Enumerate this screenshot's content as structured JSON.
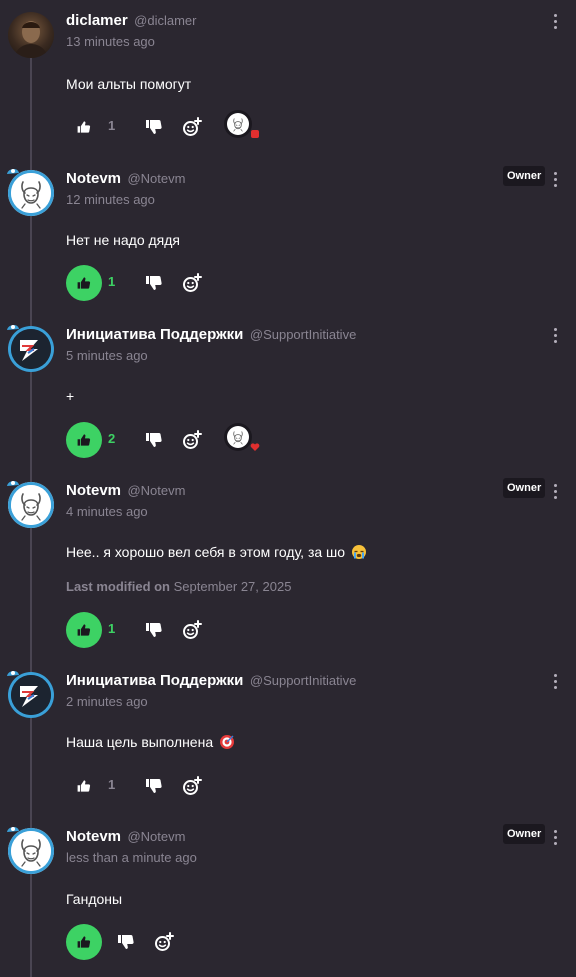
{
  "colors": {
    "background": "#2b2730",
    "like_active": "#3dd264",
    "muted": "#8a8592",
    "owner_badge_bg": "#1b181f"
  },
  "comments": [
    {
      "author": "diclamer",
      "handle": "@diclamer",
      "time": "13 minutes ago",
      "text": "Мои альты помогут",
      "likes": "1",
      "liked": false,
      "owner": false,
      "avatar": "user-photo",
      "reaction": true
    },
    {
      "author": "Notevm",
      "handle": "@Notevm",
      "time": "12 minutes ago",
      "text": "Нет не надо дядя",
      "likes": "1",
      "liked": true,
      "owner": true,
      "owner_label": "Owner",
      "avatar": "notevm-bunny",
      "reaction": false
    },
    {
      "author": "Инициатива Поддержки",
      "handle": "@SupportInitiative",
      "time": "5 minutes ago",
      "text": "+",
      "likes": "2",
      "liked": true,
      "owner": false,
      "avatar": "support-lightning",
      "reaction": true
    },
    {
      "author": "Notevm",
      "handle": "@Notevm",
      "time": "4 minutes ago",
      "text": "Нее.. я хорошо вел себя в этом году, за шо",
      "text_emoji": "crying-face-emoji",
      "modified_label": "Last modified on",
      "modified_date": "September 27, 2025",
      "likes": "1",
      "liked": true,
      "owner": true,
      "owner_label": "Owner",
      "avatar": "notevm-bunny",
      "reaction": false
    },
    {
      "author": "Инициатива Поддержки",
      "handle": "@SupportInitiative",
      "time": "2 minutes ago",
      "text": "Наша цель выполнена",
      "text_emoji": "direct-hit-emoji",
      "likes": "1",
      "liked": false,
      "owner": false,
      "avatar": "support-lightning",
      "reaction": false
    },
    {
      "author": "Notevm",
      "handle": "@Notevm",
      "time": "less than a minute ago",
      "text": "Гандоны",
      "likes": "",
      "liked": true,
      "owner": true,
      "owner_label": "Owner",
      "avatar": "notevm-bunny",
      "reaction": false
    }
  ]
}
